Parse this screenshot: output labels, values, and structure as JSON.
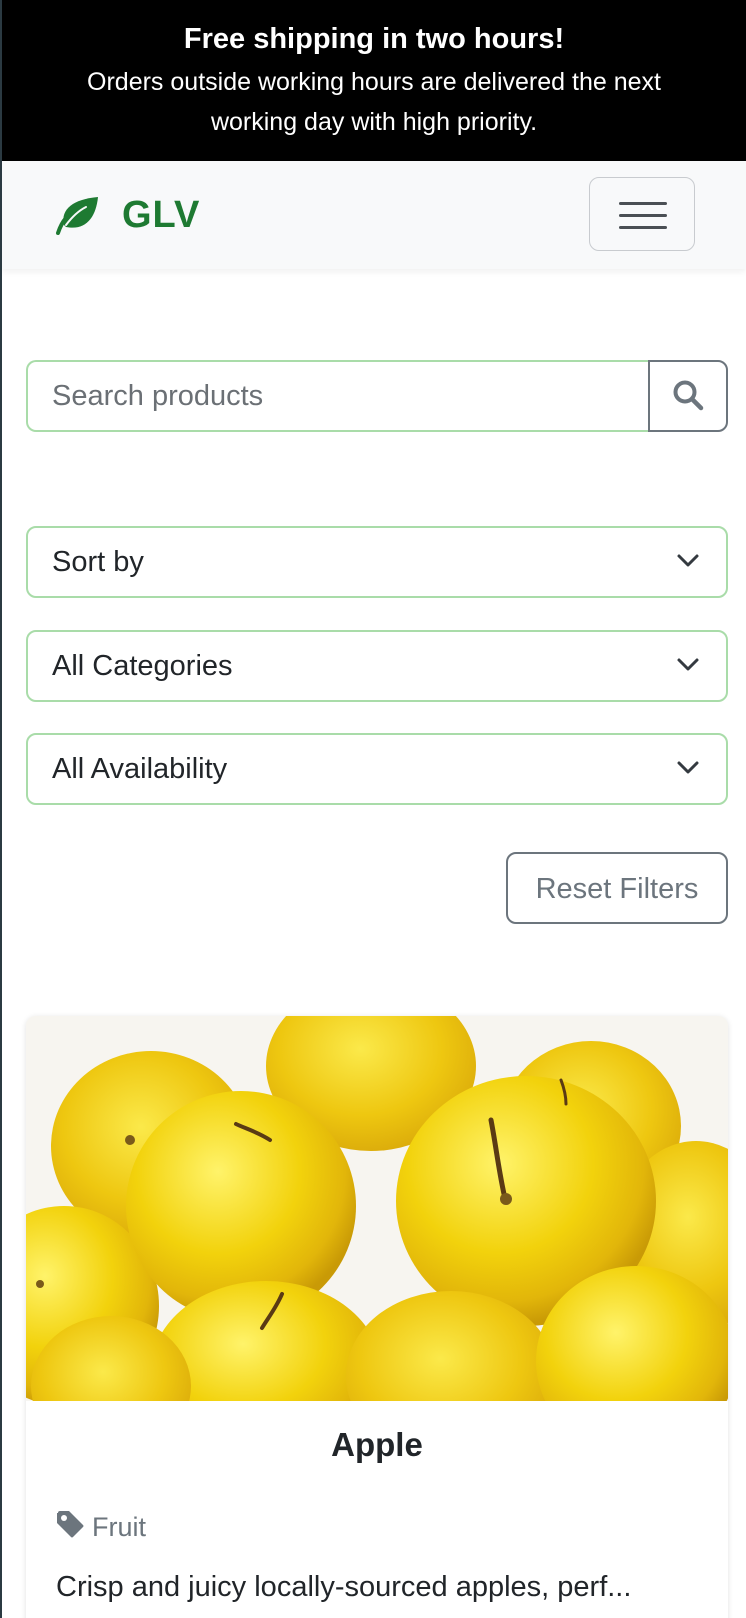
{
  "banner": {
    "title": "Free shipping in two hours!",
    "text": "Orders outside working hours are delivered the next working day with high priority."
  },
  "navbar": {
    "brand": "GLV",
    "brand_icon": "leaf-icon",
    "menu_icon": "hamburger-menu-icon",
    "brand_color": "#1e7a32"
  },
  "search": {
    "placeholder": "Search products",
    "value": "",
    "button_icon": "search-icon"
  },
  "filters": {
    "sort_by": "Sort by",
    "category": "All Categories",
    "availability": "All Availability",
    "reset_label": "Reset Filters"
  },
  "products": [
    {
      "name": "Apple",
      "category": "Fruit",
      "category_icon": "tag-icon",
      "description": "Crisp and juicy locally-sourced apples, perf..."
    }
  ]
}
